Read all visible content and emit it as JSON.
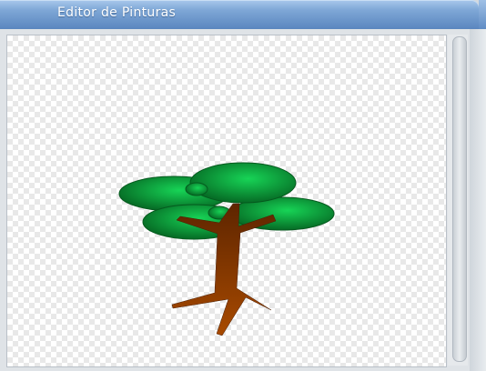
{
  "window": {
    "title": "Editor de Pinturas"
  },
  "drawing": {
    "subject": "tree",
    "colors": {
      "foliage_dark": "#066b25",
      "foliage_light": "#17d456",
      "trunk_dark": "#5e2500",
      "trunk_light": "#a84a00"
    }
  },
  "icons": {
    "scroll": "vertical-scrollbar"
  }
}
